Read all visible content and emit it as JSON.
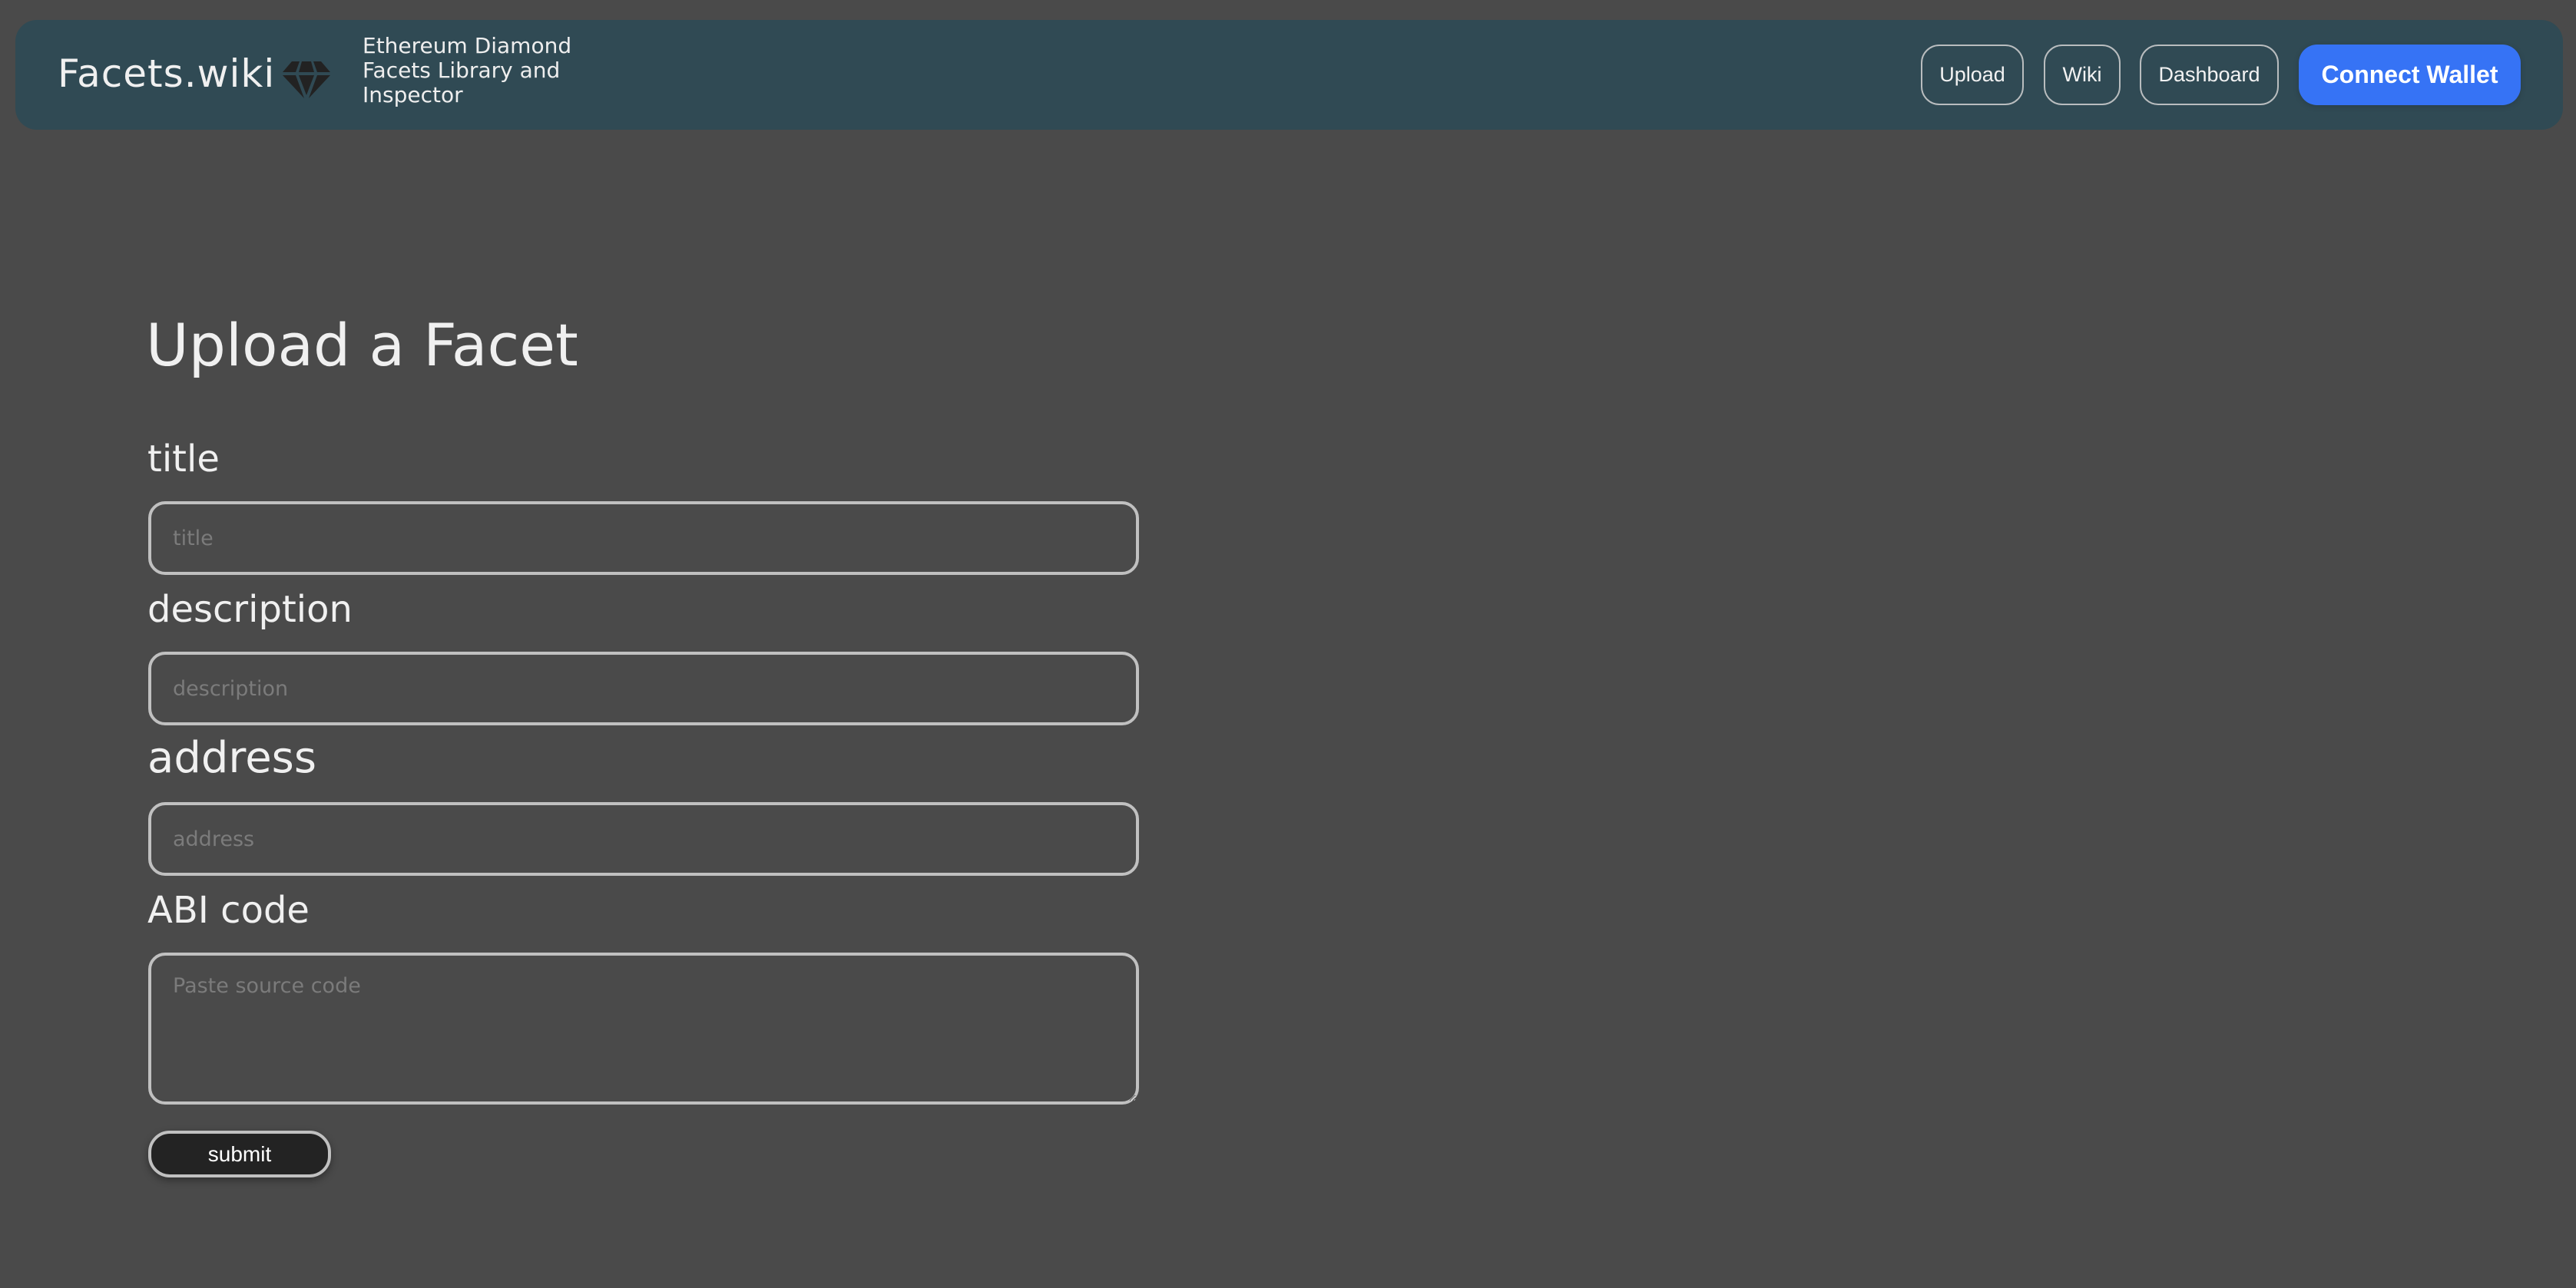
{
  "header": {
    "brand": "Facets.wiki",
    "logo_icon": "diamond-icon",
    "tagline_lines": [
      "Ethereum Diamond",
      "Facets Library and",
      "Inspector"
    ],
    "nav": {
      "upload": "Upload",
      "wiki": "Wiki",
      "dashboard": "Dashboard"
    },
    "connect_wallet": "Connect Wallet"
  },
  "form": {
    "heading": "Upload a Facet",
    "fields": {
      "title": {
        "label": "title",
        "placeholder": "title",
        "value": ""
      },
      "description": {
        "label": "description",
        "placeholder": "description",
        "value": ""
      },
      "address": {
        "label": "address",
        "placeholder": "address",
        "value": ""
      },
      "abi": {
        "label": "ABI code",
        "placeholder": "Paste source code",
        "value": ""
      }
    },
    "submit_label": "submit"
  },
  "colors": {
    "background": "#4a4a4a",
    "header": "#304a54",
    "accent": "#3673f5",
    "field_border": "#c0c0c0",
    "submit_bg": "#232323"
  }
}
